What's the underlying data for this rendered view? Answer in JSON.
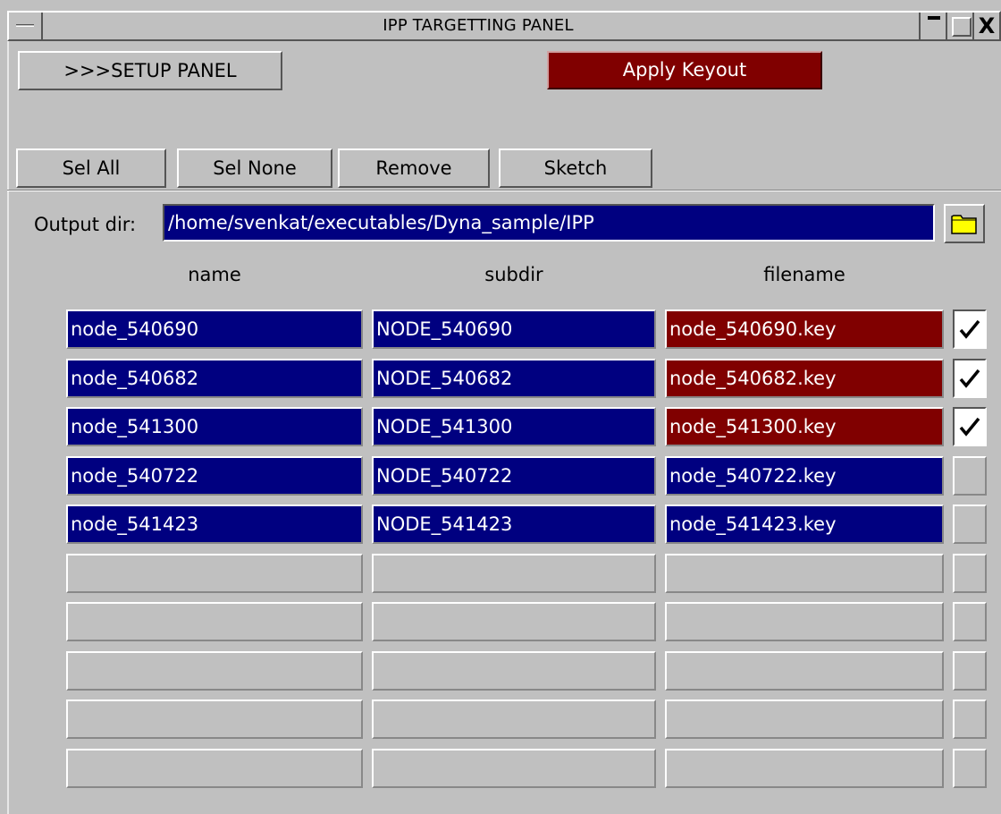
{
  "window": {
    "title": "IPP TARGETTING PANEL",
    "close_glyph": "X"
  },
  "toolbar": {
    "setup_label": ">>>SETUP PANEL",
    "apply_label": "Apply Keyout",
    "sel_all_label": "Sel All",
    "sel_none_label": "Sel None",
    "remove_label": "Remove",
    "sketch_label": "Sketch"
  },
  "output": {
    "label": "Output dir:",
    "value": "/home/svenkat/executables/Dyna_sample/IPP",
    "folder_icon": "folder-icon"
  },
  "columns": {
    "name": "name",
    "subdir": "subdir",
    "filename": "filename"
  },
  "rows": [
    {
      "name": "node_540690",
      "subdir": "NODE_540690",
      "filename": "node_540690.key",
      "checked": true
    },
    {
      "name": "node_540682",
      "subdir": "NODE_540682",
      "filename": "node_540682.key",
      "checked": true
    },
    {
      "name": "node_541300",
      "subdir": "NODE_541300",
      "filename": "node_541300.key",
      "checked": true
    },
    {
      "name": "node_540722",
      "subdir": "NODE_540722",
      "filename": "node_540722.key",
      "checked": false
    },
    {
      "name": "node_541423",
      "subdir": "NODE_541423",
      "filename": "node_541423.key",
      "checked": false
    },
    {
      "name": "",
      "subdir": "",
      "filename": "",
      "checked": false
    },
    {
      "name": "",
      "subdir": "",
      "filename": "",
      "checked": false
    },
    {
      "name": "",
      "subdir": "",
      "filename": "",
      "checked": false
    },
    {
      "name": "",
      "subdir": "",
      "filename": "",
      "checked": false
    },
    {
      "name": "",
      "subdir": "",
      "filename": "",
      "checked": false
    }
  ],
  "colors": {
    "background": "#c0c0c0",
    "field_blue": "#000080",
    "field_red": "#800000",
    "apply_red": "#800000"
  }
}
